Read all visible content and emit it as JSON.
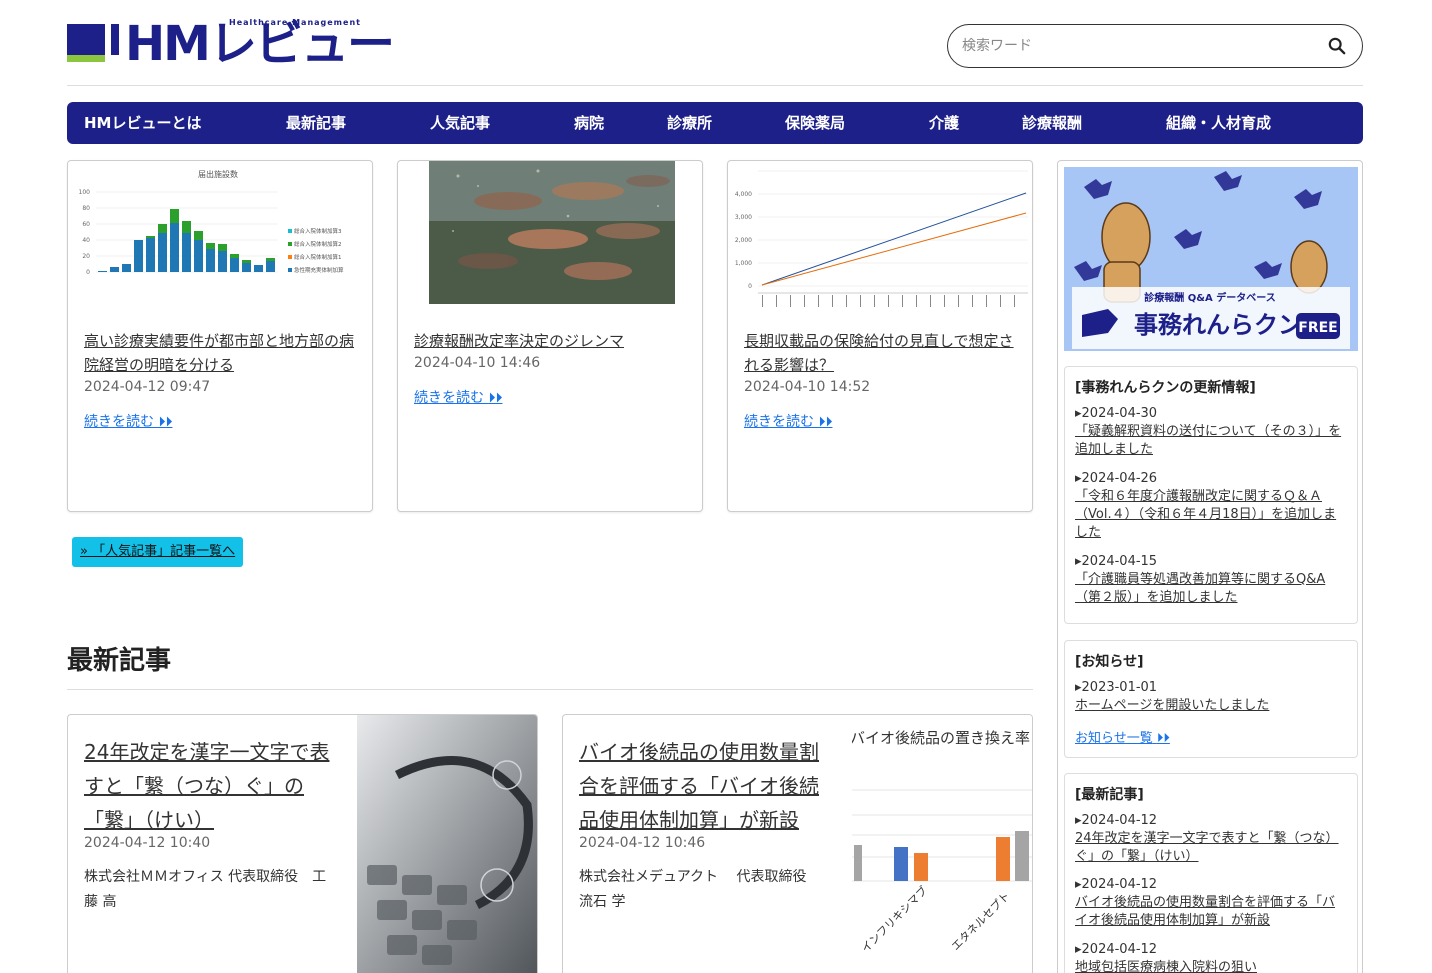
{
  "header": {
    "logo_text": "HMレビュー",
    "logo_sub": "Healthcare Management",
    "search_placeholder": "検索ワード"
  },
  "nav": [
    "HMレビューとは",
    "最新記事",
    "人気記事",
    "病院",
    "診療所",
    "保険薬局",
    "介護",
    "診療報酬",
    "組織・人材育成"
  ],
  "popular": [
    {
      "title": "高い診療実績要件が都市部と地方部の病院経営の明暗を分ける",
      "date": "2024-04-12 09:47",
      "more": "続きを読む"
    },
    {
      "title": "診療報酬改定率決定のジレンマ",
      "date": "2024-04-10 14:46",
      "more": "続きを読む"
    },
    {
      "title": "長期収載品の保険給付の見直しで想定される影響は？",
      "date": "2024-04-10 14:52",
      "more": "続きを読む"
    }
  ],
  "popular_button": "「人気記事」記事一覧へ",
  "latest_section_title": "最新記事",
  "latest": [
    {
      "title": "24年改定を漢字一文字で表すと「繋（つな）ぐ」の「繋」（けい）",
      "date": "2024-04-12 10:40",
      "author": "株式会社ＭＭオフィス 代表取締役　工藤 高"
    },
    {
      "title": "バイオ後続品の使用数量割合を評価する「バイオ後続品使用体制加算」が新設",
      "date": "2024-04-12 10:46",
      "author": "株式会社メデュアクト　 代表取締役　流石 学",
      "img_title": "バイオ後続品の置き換え率",
      "img_labels": [
        "インフリキシマブ",
        "エタネルセプト"
      ]
    }
  ],
  "chart1": {
    "title": "届出施設数",
    "yticks": [
      "100",
      "80",
      "60",
      "40",
      "20",
      "0"
    ],
    "legend": [
      "総合入院体制加算3",
      "総合入院体制加算2",
      "総合入院体制加算1",
      "急性期充実体制加算"
    ]
  },
  "chart3": {
    "yticks": [
      "4,000",
      "3,000",
      "2,000",
      "1,000",
      "0"
    ]
  },
  "sidebar": {
    "banner_small": "診療報酬 Q&A データベース",
    "banner_big": "事務れんらクン",
    "banner_free": "FREE",
    "renraku": {
      "title": "[事務れんらクンの更新情報]",
      "items": [
        {
          "date": "2024-04-30",
          "text": "「疑義解釈資料の送付について（その３）」を追加しました"
        },
        {
          "date": "2024-04-26",
          "text": "「令和６年度介護報酬改定に関するＱ＆Ａ（Vol.４）（令和６年４月18日）」を追加しました"
        },
        {
          "date": "2024-04-15",
          "text": "「介護職員等処遇改善加算等に関するQ&A（第２版）」を追加しました"
        }
      ]
    },
    "notice": {
      "title": "[お知らせ]",
      "items": [
        {
          "date": "2023-01-01",
          "text": "ホームページを開設いたしました"
        }
      ],
      "more": "お知らせ一覧"
    },
    "latest": {
      "title": "[最新記事]",
      "items": [
        {
          "date": "2024-04-12",
          "text": "24年改定を漢字一文字で表すと「繋（つな）ぐ」の「繋」（けい）"
        },
        {
          "date": "2024-04-12",
          "text": "バイオ後続品の使用数量割合を評価する「バイオ後続品使用体制加算」が新設"
        },
        {
          "date": "2024-04-12",
          "text": "地域包括医療病棟入院料の狙い"
        }
      ]
    }
  },
  "colors": {
    "brand": "#1d2088",
    "accent_green": "#8cc63f",
    "button_cyan": "#12c0e8",
    "link": "#1a73e8"
  }
}
